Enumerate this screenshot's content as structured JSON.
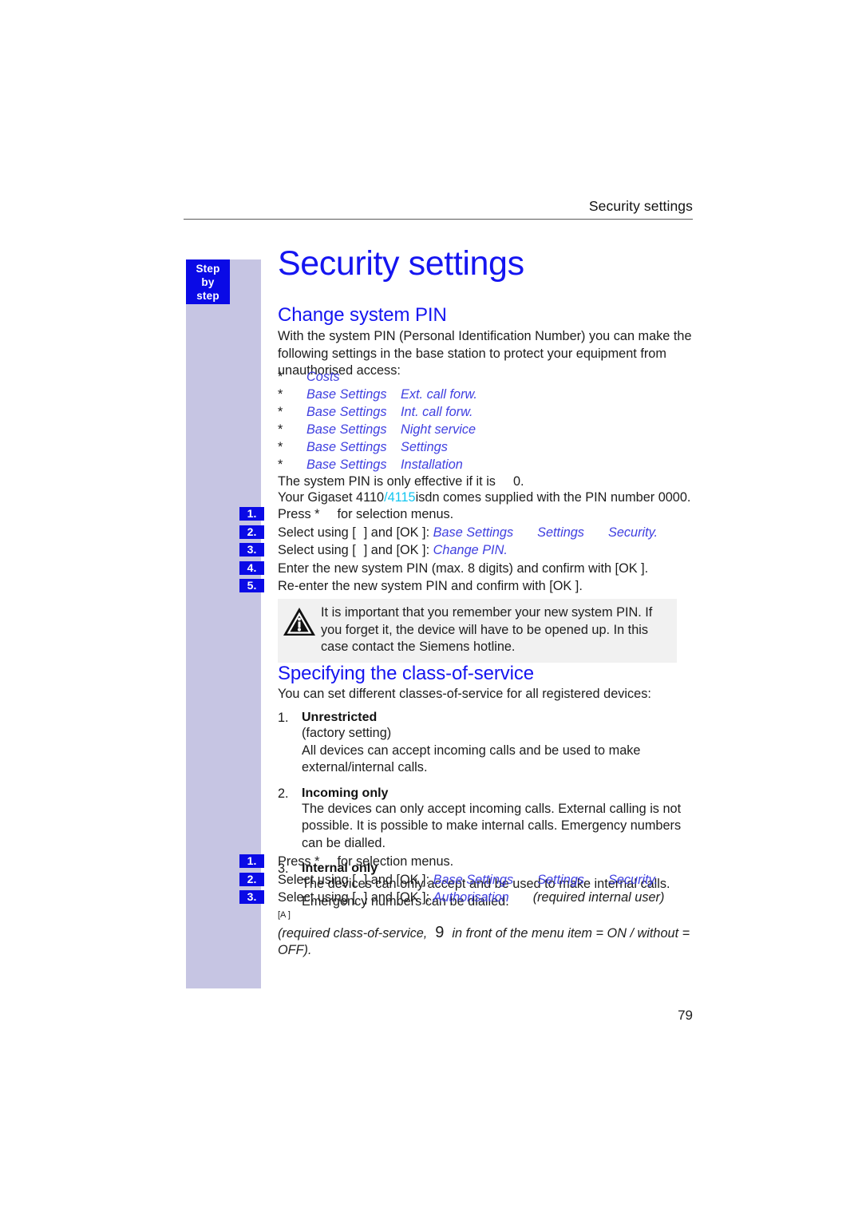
{
  "page": {
    "running_header": "Security settings",
    "folio": "79",
    "side_tab": {
      "line1": "Step",
      "line2": "by",
      "line3": "step"
    },
    "colors": {
      "heading_blue": "#1515f0",
      "menu_italic_blue": "#4040e0",
      "tab_blue": "#0a0ae6",
      "side_band_lavender": "#c6c5e3",
      "highlight_cyan": "#13c6f0",
      "note_background": "#f1f1f1"
    }
  },
  "title": "Security settings",
  "section_pin": {
    "heading": "Change system PIN",
    "intro": "With the system PIN (Personal Identification Number) you can make the following settings in the base station to protect your equipment from unauthorised access:",
    "menu_paths": [
      {
        "bullet": "*",
        "first": "Costs",
        "second": ""
      },
      {
        "bullet": "*",
        "first": "Base Settings",
        "second": "Ext. call forw."
      },
      {
        "bullet": "*",
        "first": "Base Settings",
        "second": "Int. call forw."
      },
      {
        "bullet": "*",
        "first": "Base Settings",
        "second": "Night service"
      },
      {
        "bullet": "*",
        "first": "Base Settings",
        "second": "Settings"
      },
      {
        "bullet": "*",
        "first": "Base Settings",
        "second": "Installation"
      }
    ],
    "effective_note_prefix": "The system PIN is only effective if it is",
    "effective_note_suffix": "0.",
    "supplied_note": {
      "prefix": "Your Gigaset 4110",
      "highlight": "/4115",
      "suffix": "isdn comes supplied with the PIN number 0000."
    },
    "steps": [
      {
        "num": "1.",
        "text_before": "Press *",
        "text_after": "for selection menus."
      },
      {
        "num": "2.",
        "text_before": "Select using [",
        "text_mid": "] and [OK ]:",
        "menu1": "Base Settings",
        "menu2": "Settings",
        "menu3": "Security."
      },
      {
        "num": "3.",
        "text_before": "Select using [",
        "text_mid": "] and [OK ]:",
        "menu1": "Change PIN."
      },
      {
        "num": "4.",
        "text": "Enter the new system PIN (max. 8 digits) and confirm with [OK ]."
      },
      {
        "num": "5.",
        "text": "Re-enter the new system PIN and confirm with [OK ]."
      }
    ],
    "warning": {
      "icon": "warning-triangle-icon",
      "text": "It is important that you remember your new system PIN. If you forget it, the device will have to be opened up. In this case contact the Siemens hotline."
    }
  },
  "section_cos": {
    "heading": "Specifying the class-of-service",
    "intro": "You can set different classes-of-service for all registered devices:",
    "items": [
      {
        "num": "1.",
        "name": "Unrestricted",
        "desc": "(factory setting)\nAll devices can accept incoming calls and be used to make external/internal calls."
      },
      {
        "num": "2.",
        "name": "Incoming only",
        "desc": "The devices can only accept incoming calls. External calling is not possible. It is possible to make internal calls. Emergency numbers can be dialled."
      },
      {
        "num": "3.",
        "name": "Internal only",
        "desc": "The devices can only accept and be used to make internal calls. Emergency numbers can be dialled."
      }
    ],
    "steps": [
      {
        "num": "1.",
        "text_before": "Press *",
        "text_after": "for selection menus."
      },
      {
        "num": "2.",
        "text_before": "Select using [",
        "text_mid": "] and [OK ]:",
        "menu1": "Base Settings",
        "menu2": "Settings",
        "menu3": "Security."
      },
      {
        "num": "3.",
        "text_before": "Select using [",
        "text_mid": "] and [OK ]:",
        "menu1": "Authorisation",
        "paren1": "(required internal user)",
        "glyph": "[A  ]",
        "line2_a": "(required class-of-service,",
        "line2_big": "9",
        "line2_b": "in front of the menu item = ON / without = OFF)."
      }
    ]
  }
}
